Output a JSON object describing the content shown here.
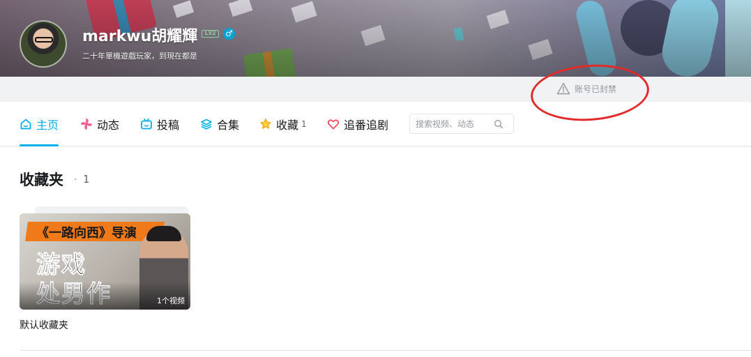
{
  "profile": {
    "username": "markwu胡耀輝",
    "level_badge": "LV2",
    "gender_symbol": "♂",
    "signature": "二十年單機遊戲玩家，到現在都是"
  },
  "status": {
    "banned_text": "账号已封禁",
    "icon": "warning-triangle-icon"
  },
  "nav": {
    "items": [
      {
        "label": "主页",
        "icon": "home-icon",
        "active": true
      },
      {
        "label": "动态",
        "icon": "pinwheel-icon"
      },
      {
        "label": "投稿",
        "icon": "tv-icon"
      },
      {
        "label": "合集",
        "icon": "layers-icon"
      },
      {
        "label": "收藏",
        "icon": "star-icon",
        "count": "1"
      },
      {
        "label": "追番追剧",
        "icon": "heart-icon"
      }
    ],
    "search_placeholder": "搜索视频、动态"
  },
  "section": {
    "title": "收藏夹",
    "separator": "·",
    "count": "1"
  },
  "folders": [
    {
      "title": "默认收藏夹",
      "video_count": "1个视频",
      "cover_text": {
        "line1": "《一路向西》导演",
        "line2": "游戏",
        "line3": "处男作"
      }
    }
  ],
  "colors": {
    "accent": "#00aeec",
    "annotation": "#e32a2a",
    "level": "#8bd29e"
  }
}
